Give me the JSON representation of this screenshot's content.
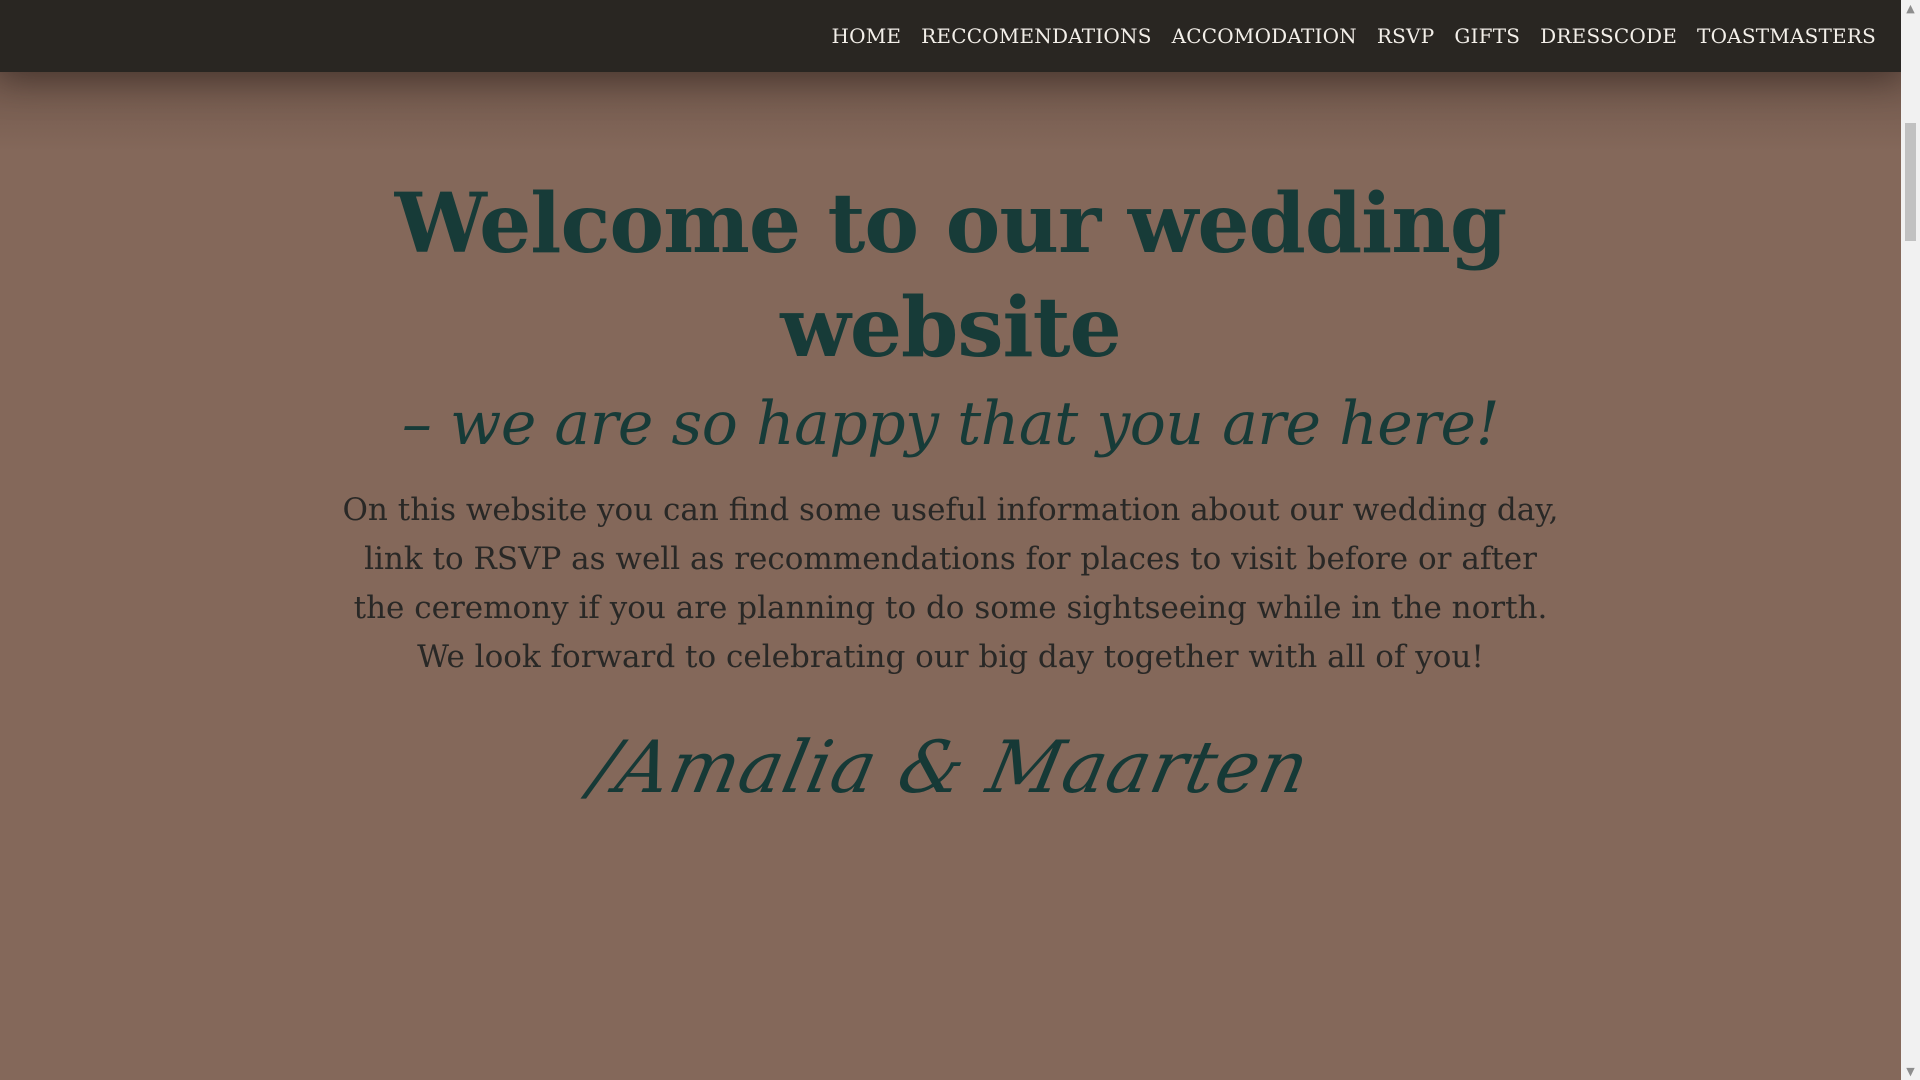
{
  "nav": {
    "items": [
      {
        "label": "HOME"
      },
      {
        "label": "RECCOMENDATIONS"
      },
      {
        "label": "ACCOMODATION"
      },
      {
        "label": "RSVP"
      },
      {
        "label": "GIFTS"
      },
      {
        "label": "DRESSCODE"
      },
      {
        "label": "TOASTMASTERS"
      }
    ]
  },
  "hero": {
    "title_line_1": "Welcome to our wedding",
    "title_line_2": "website",
    "subtitle": "– we are so happy that you are here!",
    "intro": "On this website you can find some useful information about our wedding day, link to RSVP as well as recommendations for places to visit before or after the ceremony if you are planning to do some sightseeing while in the north. We look forward to celebrating our big day together with all of you!",
    "signature": "/Amalia & Maarten"
  },
  "colors": {
    "nav_background": "#292622",
    "page_background": "#84685a",
    "heading_text": "#173b38",
    "body_text": "#292826",
    "nav_text": "#f3efe9"
  },
  "icons": {
    "scroll_up": "chevron-up-icon",
    "scroll_down": "chevron-down-icon"
  },
  "scrollbar": {
    "up_arrow": "▲",
    "down_arrow": "▼"
  }
}
